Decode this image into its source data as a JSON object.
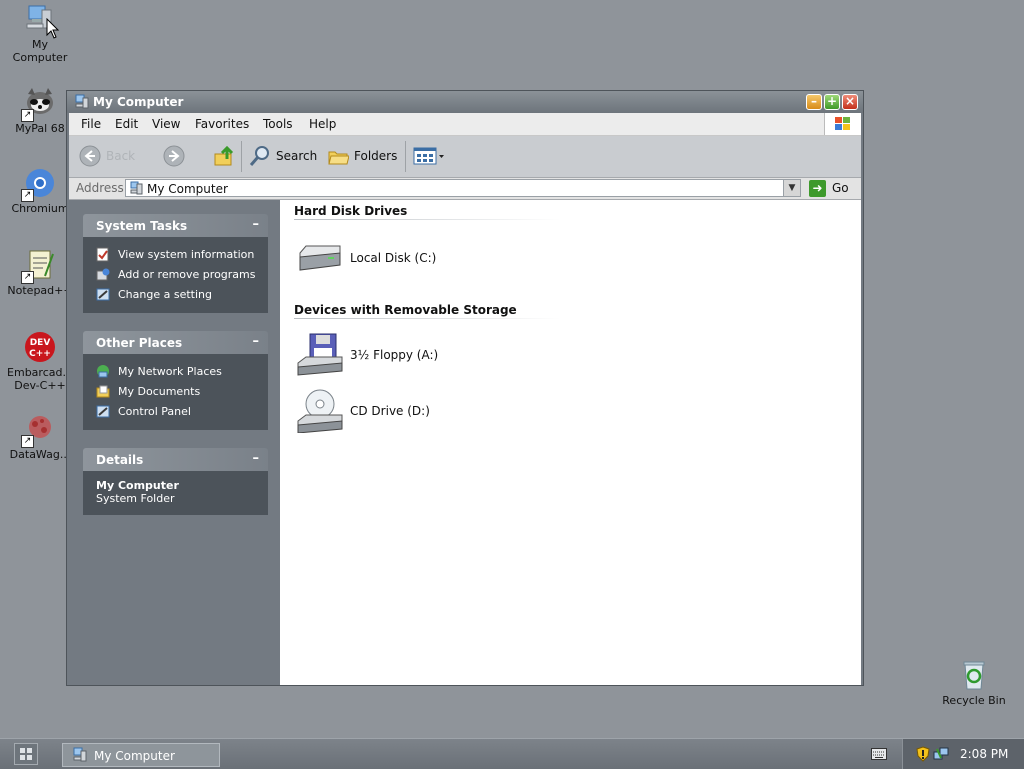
{
  "desktop": {
    "icons": [
      {
        "label": "My Computer",
        "icon": "computer-icon"
      },
      {
        "label": "MyPal 68",
        "icon": "raccoon-icon"
      },
      {
        "label": "Chromium",
        "icon": "chromium-icon"
      },
      {
        "label": "Notepad++",
        "icon": "notepad-icon"
      },
      {
        "label": "Embarcad... Dev-C++",
        "icon": "devcpp-icon"
      },
      {
        "label": "DataWag...",
        "icon": "datawag-icon"
      },
      {
        "label": "Recycle Bin",
        "icon": "recycle-bin-icon"
      }
    ]
  },
  "window": {
    "title": "My Computer",
    "menu": [
      "File",
      "Edit",
      "View",
      "Favorites",
      "Tools",
      "Help"
    ],
    "toolbar": {
      "back": "Back",
      "search": "Search",
      "folders": "Folders"
    },
    "address": {
      "label": "Address",
      "value": "My Computer",
      "go": "Go"
    }
  },
  "taskpane": {
    "system_tasks": {
      "title": "System Tasks",
      "items": [
        "View system information",
        "Add or remove programs",
        "Change a setting"
      ]
    },
    "other_places": {
      "title": "Other Places",
      "items": [
        "My Network Places",
        "My Documents",
        "Control Panel"
      ]
    },
    "details": {
      "title": "Details",
      "name": "My Computer",
      "type": "System Folder"
    }
  },
  "content": {
    "groups": [
      {
        "title": "Hard Disk Drives",
        "items": [
          {
            "label": "Local Disk (C:)",
            "icon": "hard-disk-icon"
          }
        ]
      },
      {
        "title": "Devices with Removable Storage",
        "items": [
          {
            "label": "3½ Floppy (A:)",
            "icon": "floppy-drive-icon"
          },
          {
            "label": "CD Drive (D:)",
            "icon": "cd-drive-icon"
          }
        ]
      }
    ]
  },
  "taskbar": {
    "task_label": "My Computer",
    "clock": "2:08 PM"
  },
  "colors": {
    "desktop": "#8f949a",
    "window_frame": "#737a82",
    "panel_body": "#4c535a",
    "go_green": "#3e9a2c"
  }
}
